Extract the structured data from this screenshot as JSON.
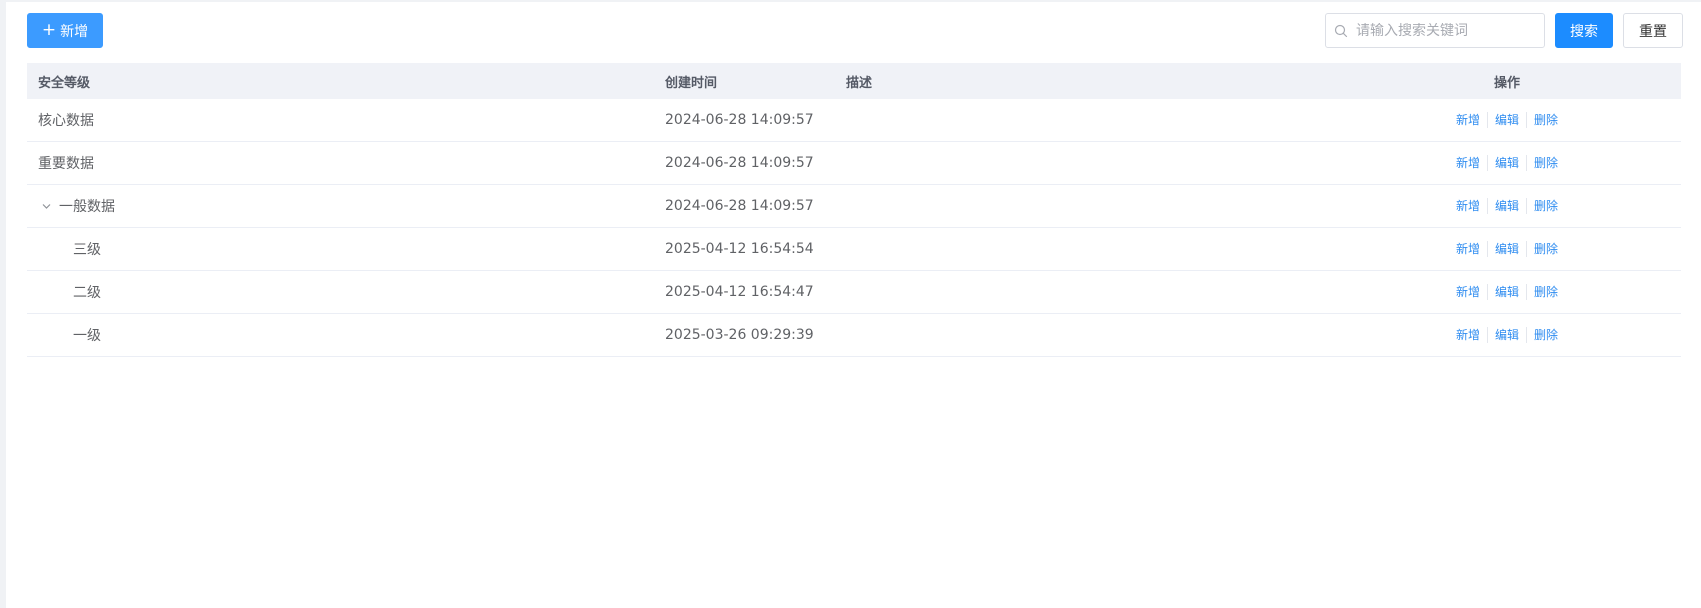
{
  "toolbar": {
    "add_label": "新增",
    "add_icon": "plus-icon",
    "search_placeholder": "请输入搜索关键词",
    "search_value": "",
    "search_label": "搜索",
    "reset_label": "重置"
  },
  "table": {
    "columns": {
      "name": "安全等级",
      "created": "创建时间",
      "desc": "描述",
      "ops": "操作"
    },
    "rows": [
      {
        "name": "核心数据",
        "created": "2024-06-28 14:09:57",
        "desc": "",
        "level": 0
      },
      {
        "name": "重要数据",
        "created": "2024-06-28 14:09:57",
        "desc": "",
        "level": 0
      },
      {
        "name": "一般数据",
        "created": "2024-06-28 14:09:57",
        "desc": "",
        "level": 0,
        "expanded": true
      },
      {
        "name": "三级",
        "created": "2025-04-12 16:54:54",
        "desc": "",
        "level": 1
      },
      {
        "name": "二级",
        "created": "2025-04-12 16:54:47",
        "desc": "",
        "level": 1
      },
      {
        "name": "一级",
        "created": "2025-03-26 09:29:39",
        "desc": "",
        "level": 1
      }
    ],
    "row_ops": {
      "add": "新增",
      "edit": "编辑",
      "delete": "删除"
    }
  },
  "colors": {
    "primary": "#1c8cff",
    "link": "#2e8cf0",
    "header_bg": "#f0f2f7"
  }
}
